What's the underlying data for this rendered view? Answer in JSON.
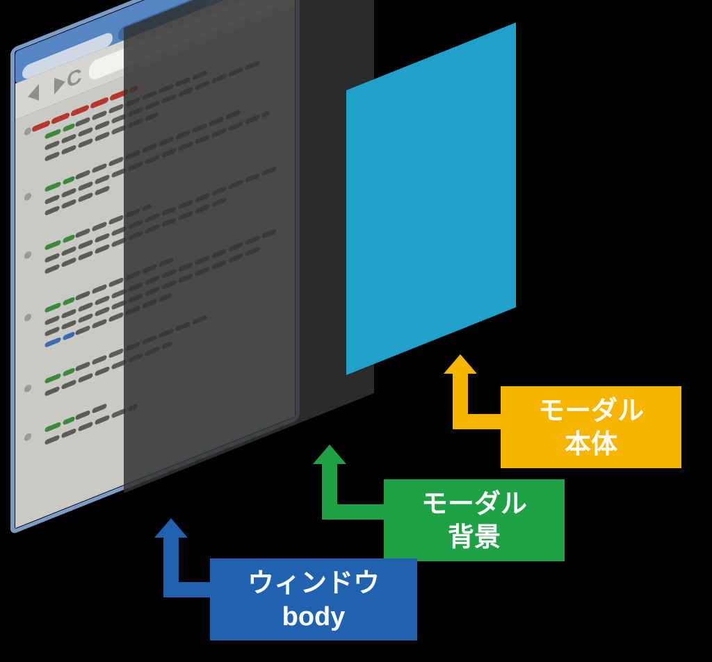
{
  "labels": {
    "modal_body": {
      "line1": "モーダル",
      "line2": "本体"
    },
    "modal_background": {
      "line1": "モーダル",
      "line2": "背景"
    },
    "window_body": {
      "line1": "ウィンドウ",
      "line2": "body"
    }
  },
  "colors": {
    "modal_body_fill": "#f8b500",
    "modal_background_fill": "#1fa146",
    "window_body_fill": "#2062af",
    "modal_panel": "#20a1cc",
    "backdrop_panel": "#333333",
    "browser_title_blue": "#5585c3",
    "browser_frame_outline": "#3b6aa0",
    "browser_toolbar": "#d5d6d2",
    "browser_body": "#c9c9c5",
    "browser_accent_red": "#b8372d",
    "browser_accent_green": "#3a8a3a",
    "browser_accent_blue": "#3a6ab2",
    "browser_accent_gray": "#5b5c58",
    "label_text": "#ffffff"
  }
}
